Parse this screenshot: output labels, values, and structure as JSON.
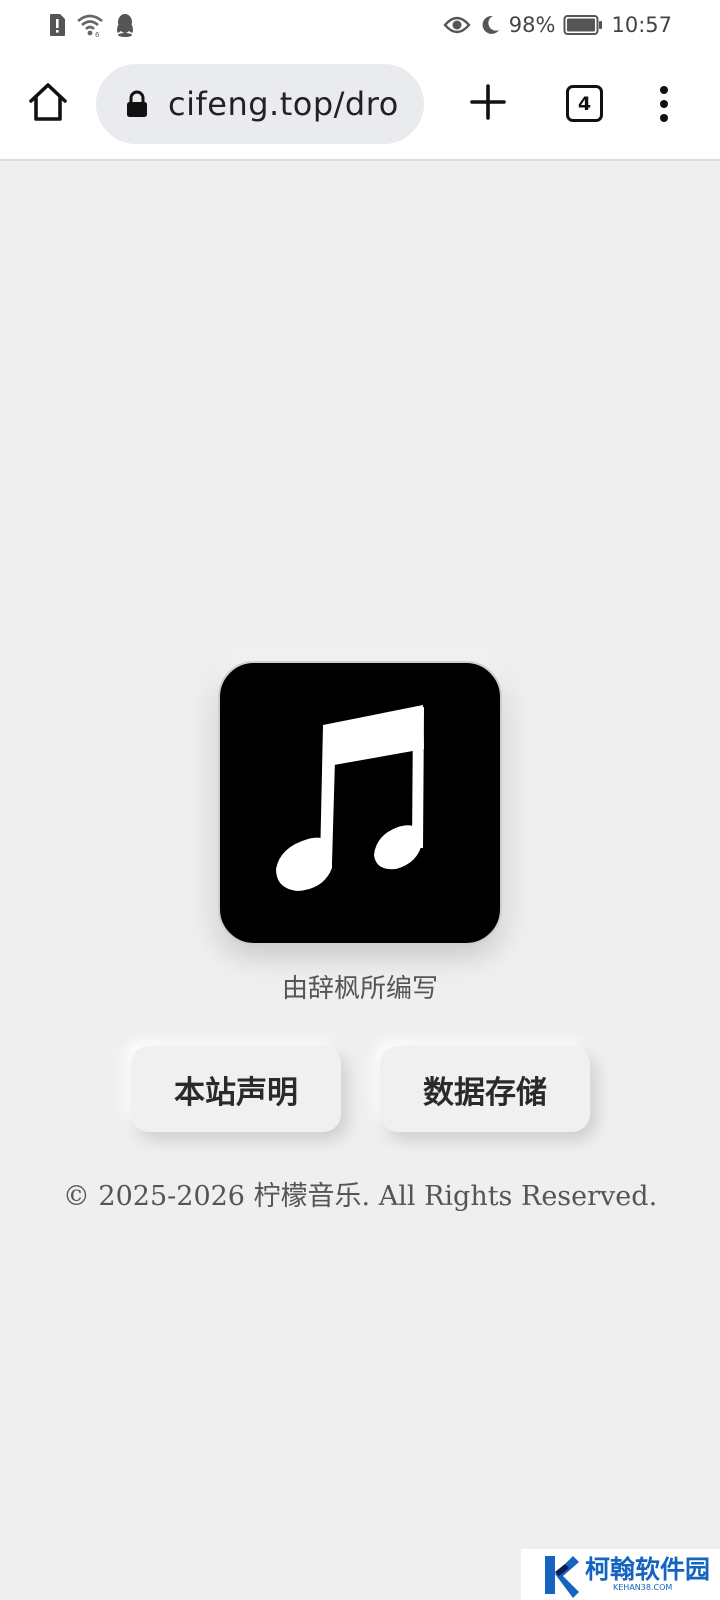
{
  "status_bar": {
    "battery_percent": "98%",
    "time": "10:57",
    "icons": [
      "alert-sim-icon",
      "wifi-icon",
      "qq-icon",
      "eye-icon",
      "moon-icon",
      "battery-icon"
    ]
  },
  "browser": {
    "url": "cifeng.top/dro",
    "tab_count": "4",
    "icons": [
      "home-icon",
      "lock-icon",
      "plus-icon",
      "tabs-icon",
      "more-vert-icon"
    ]
  },
  "main": {
    "app_icon": "music-note-icon",
    "author_text": "由辞枫所编写",
    "buttons": {
      "notice_label": "本站声明",
      "storage_label": "数据存储"
    },
    "copyright": "© 2025-2026 柠檬音乐. All Rights Reserved."
  },
  "watermark": {
    "title": "柯翰软件园",
    "subtitle": "KEHAN38.COM"
  },
  "colors": {
    "page_background": "#efefef",
    "watermark_blue": "#1565c0"
  }
}
